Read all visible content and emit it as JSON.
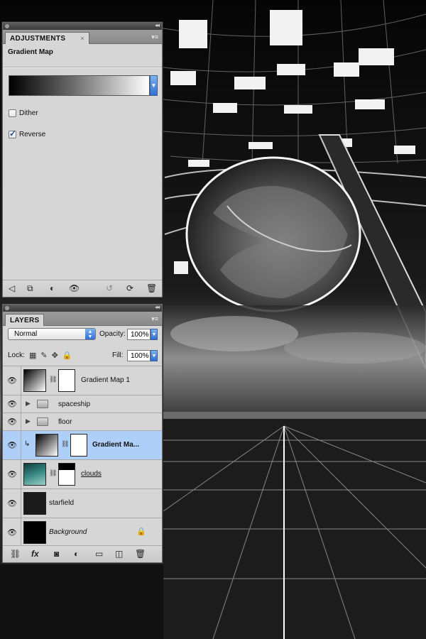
{
  "adjustments_panel": {
    "tab_label": "ADJUSTMENTS",
    "title": "Gradient Map",
    "dither_label": "Dither",
    "dither_checked": false,
    "reverse_label": "Reverse",
    "reverse_checked": true
  },
  "layers_panel": {
    "tab_label": "LAYERS",
    "blend_mode": "Normal",
    "opacity_label": "Opacity:",
    "opacity_value": "100%",
    "lock_label": "Lock:",
    "fill_label": "Fill:",
    "fill_value": "100%",
    "layers": [
      {
        "name": "Gradient Map 1",
        "kind": "adjustment",
        "visible": true,
        "selected": false,
        "clipped": false
      },
      {
        "name": "spaceship",
        "kind": "group",
        "visible": true,
        "selected": false,
        "clipped": false
      },
      {
        "name": "floor",
        "kind": "group",
        "visible": true,
        "selected": false,
        "clipped": false
      },
      {
        "name": "Gradient Ma...",
        "kind": "adjustment",
        "visible": true,
        "selected": true,
        "clipped": true
      },
      {
        "name": "clouds",
        "kind": "pixel",
        "visible": true,
        "selected": false,
        "clipped": false
      },
      {
        "name": "starfield",
        "kind": "pixel",
        "visible": true,
        "selected": false,
        "clipped": false
      },
      {
        "name": "Background",
        "kind": "background",
        "visible": true,
        "selected": false,
        "clipped": false,
        "locked": true
      }
    ]
  },
  "colors": {
    "panel_bg": "#d6d6d6",
    "selection": "#aecff8",
    "accent_blue": "#2f6fd4"
  }
}
